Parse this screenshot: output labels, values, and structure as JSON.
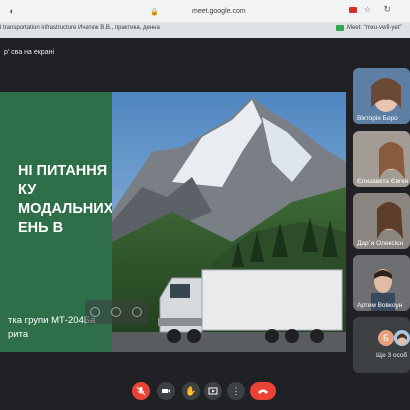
{
  "browser": {
    "url": "meet.google.com",
    "tabs": [
      {
        "title": "l transportation infrastructure Ичатюк В.В., практика, денна"
      },
      {
        "title": "Meet: \"mxu-vwfi-yet\""
      }
    ]
  },
  "meeting": {
    "presenter_label": "р' сва на екрані"
  },
  "slide": {
    "title_lines": [
      "НІ ПИТАННЯ",
      "КУ",
      "МОДАЛЬНИХ",
      "ЕНЬ В"
    ],
    "footer_lines": [
      "тка групи МТ-204Ба",
      "рита"
    ]
  },
  "participants": [
    {
      "name": "Вікторія Боро"
    },
    {
      "name": "Єлизавета Євген"
    },
    {
      "name": "Дар`я Олексієн"
    },
    {
      "name": "Артем Вовкоун"
    }
  ],
  "others": {
    "avatar_letter": "Б",
    "label": "Ще 3 особ"
  },
  "colors": {
    "slide_green": "#2e6e48",
    "end_call_red": "#ea4335",
    "meet_bg": "#202124"
  }
}
